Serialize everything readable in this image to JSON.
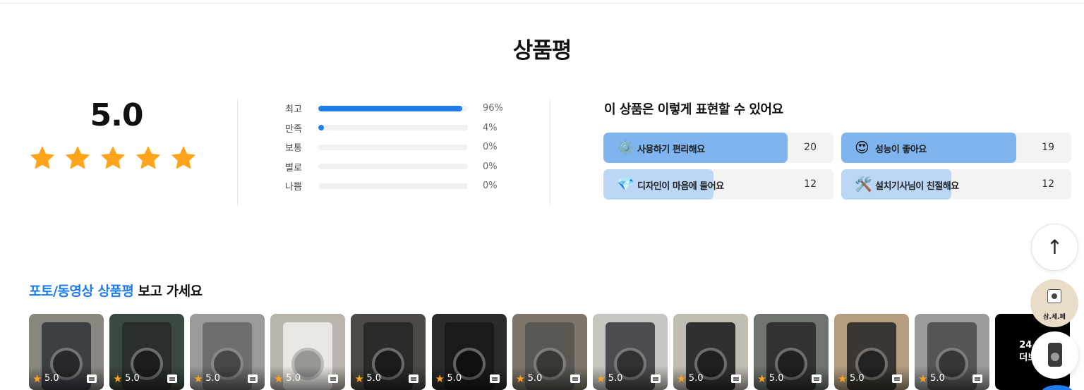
{
  "section_title": "상품평",
  "summary": {
    "score": "5.0",
    "stars": 5
  },
  "distribution": [
    {
      "label": "최고",
      "percent_text": "96%",
      "value": 0.96
    },
    {
      "label": "만족",
      "percent_text": "4%",
      "value": 0.04
    },
    {
      "label": "보통",
      "percent_text": "0%",
      "value": 0
    },
    {
      "label": "별로",
      "percent_text": "0%",
      "value": 0
    },
    {
      "label": "나쁨",
      "percent_text": "0%",
      "value": 0
    }
  ],
  "keywords": {
    "title": "이 상품은 이렇게 표현할 수 있어요",
    "items": [
      {
        "icon": "gear-icon",
        "glyph": "⚙️",
        "label": "사용하기 편리해요",
        "count": "20",
        "value": 20
      },
      {
        "icon": "heart-eyes-icon",
        "glyph": "😍",
        "label": "성능이 좋아요",
        "count": "19",
        "value": 19
      },
      {
        "icon": "diamond-icon",
        "glyph": "💎",
        "label": "디자인이 마음에 들어요",
        "count": "12",
        "value": 12
      },
      {
        "icon": "tools-icon",
        "glyph": "🛠️",
        "label": "설치기사님이 친절해요",
        "count": "12",
        "value": 12
      }
    ],
    "colors": {
      "high": "#7fb4ef",
      "low": "#bcd6f6"
    }
  },
  "photo_section": {
    "title_highlight": "포토/동영상 상품평",
    "title_rest": " 보고 가세요",
    "thumbnails": [
      {
        "score": "5.0",
        "bg": "#8a8780",
        "machine": "#3c3f44"
      },
      {
        "score": "5.0",
        "bg": "#3b4a3f",
        "machine": "#2a2f2c"
      },
      {
        "score": "5.0",
        "bg": "#9a9a98",
        "machine": "#6d6e70"
      },
      {
        "score": "5.0",
        "bg": "#b9b4ad",
        "machine": "#eae8e4"
      },
      {
        "score": "5.0",
        "bg": "#4d4a45",
        "machine": "#2a2a28"
      },
      {
        "score": "5.0",
        "bg": "#2b2b2b",
        "machine": "#1a1a1a"
      },
      {
        "score": "5.0",
        "bg": "#7d7669",
        "machine": "#595853"
      },
      {
        "score": "5.0",
        "bg": "#c8c6c1",
        "machine": "#4a4c4f"
      },
      {
        "score": "5.0",
        "bg": "#c2bdb3",
        "machine": "#2f3032"
      },
      {
        "score": "5.0",
        "bg": "#6f756e",
        "machine": "#303234"
      },
      {
        "score": "5.0",
        "bg": "#b49d80",
        "machine": "#3a3733"
      },
      {
        "score": "5.0",
        "bg": "#9c9c9c",
        "machine": "#555555"
      }
    ],
    "more": {
      "count": "24",
      "label": "더보기"
    }
  },
  "floating": {
    "scroll_top_glyph": "↑",
    "shop_label": "삼.세.페"
  },
  "colors": {
    "accent": "#1f7cea",
    "star": "#ffa31a"
  }
}
